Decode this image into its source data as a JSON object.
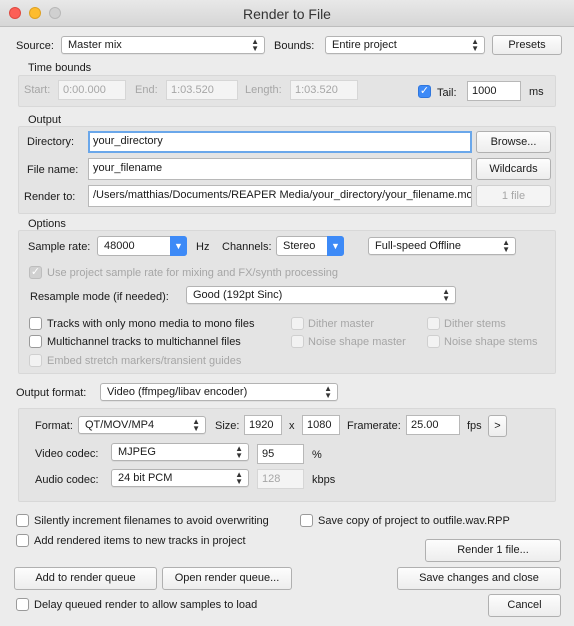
{
  "window": {
    "title": "Render to File"
  },
  "source": {
    "label": "Source:",
    "value": "Master mix"
  },
  "bounds": {
    "label": "Bounds:",
    "value": "Entire project"
  },
  "presets_label": "Presets",
  "time_bounds": {
    "title": "Time bounds",
    "start_label": "Start:",
    "start_value": "0:00.000",
    "end_label": "End:",
    "end_value": "1:03.520",
    "length_label": "Length:",
    "length_value": "1:03.520",
    "tail_label": "Tail:",
    "tail_value": "1000",
    "tail_unit": "ms"
  },
  "output": {
    "title": "Output",
    "directory_label": "Directory:",
    "directory_value": "your_directory",
    "browse_label": "Browse...",
    "filename_label": "File name:",
    "filename_value": "your_filename",
    "wildcards_label": "Wildcards",
    "render_to_label": "Render to:",
    "render_to_value": "/Users/matthias/Documents/REAPER Media/your_directory/your_filename.mov",
    "file_count_label": "1 file"
  },
  "options": {
    "title": "Options",
    "sample_rate_label": "Sample rate:",
    "sample_rate_value": "48000",
    "hz": "Hz",
    "channels_label": "Channels:",
    "channels_value": "Stereo",
    "render_speed_value": "Full-speed Offline",
    "use_project_rate_label": "Use project sample rate for mixing and FX/synth processing",
    "resample_label": "Resample mode (if needed):",
    "resample_value": "Good (192pt Sinc)",
    "mono_label": "Tracks with only mono media to mono files",
    "multichannel_label": "Multichannel tracks to multichannel files",
    "embed_label": "Embed stretch markers/transient guides",
    "dither_master_label": "Dither master",
    "noise_master_label": "Noise shape master",
    "dither_stems_label": "Dither stems",
    "noise_stems_label": "Noise shape stems"
  },
  "output_format": {
    "label": "Output format:",
    "value": "Video (ffmpeg/libav encoder)"
  },
  "video": {
    "format_label": "Format:",
    "format_value": "QT/MOV/MP4",
    "size_label": "Size:",
    "width": "1920",
    "x": "x",
    "height": "1080",
    "framerate_label": "Framerate:",
    "framerate_value": "25.00",
    "fps": "fps",
    "more_label": ">",
    "video_codec_label": "Video codec:",
    "video_codec_value": "MJPEG",
    "quality_value": "95",
    "percent": "%",
    "audio_codec_label": "Audio codec:",
    "audio_codec_value": "24 bit PCM",
    "kbps_value": "128",
    "kbps": "kbps"
  },
  "bottom": {
    "silently_label": "Silently increment filenames to avoid overwriting",
    "save_copy_label": "Save copy of project to outfile.wav.RPP",
    "add_tracks_label": "Add rendered items to new tracks in project",
    "render_label": "Render 1 file...",
    "add_queue_label": "Add to render queue",
    "open_queue_label": "Open render queue...",
    "save_close_label": "Save changes and close",
    "delay_label": "Delay queued render to allow samples to load",
    "cancel_label": "Cancel"
  },
  "colors": {
    "accent": "#3d8af7",
    "focus": "#6aa7ea",
    "window": "#ececec"
  }
}
